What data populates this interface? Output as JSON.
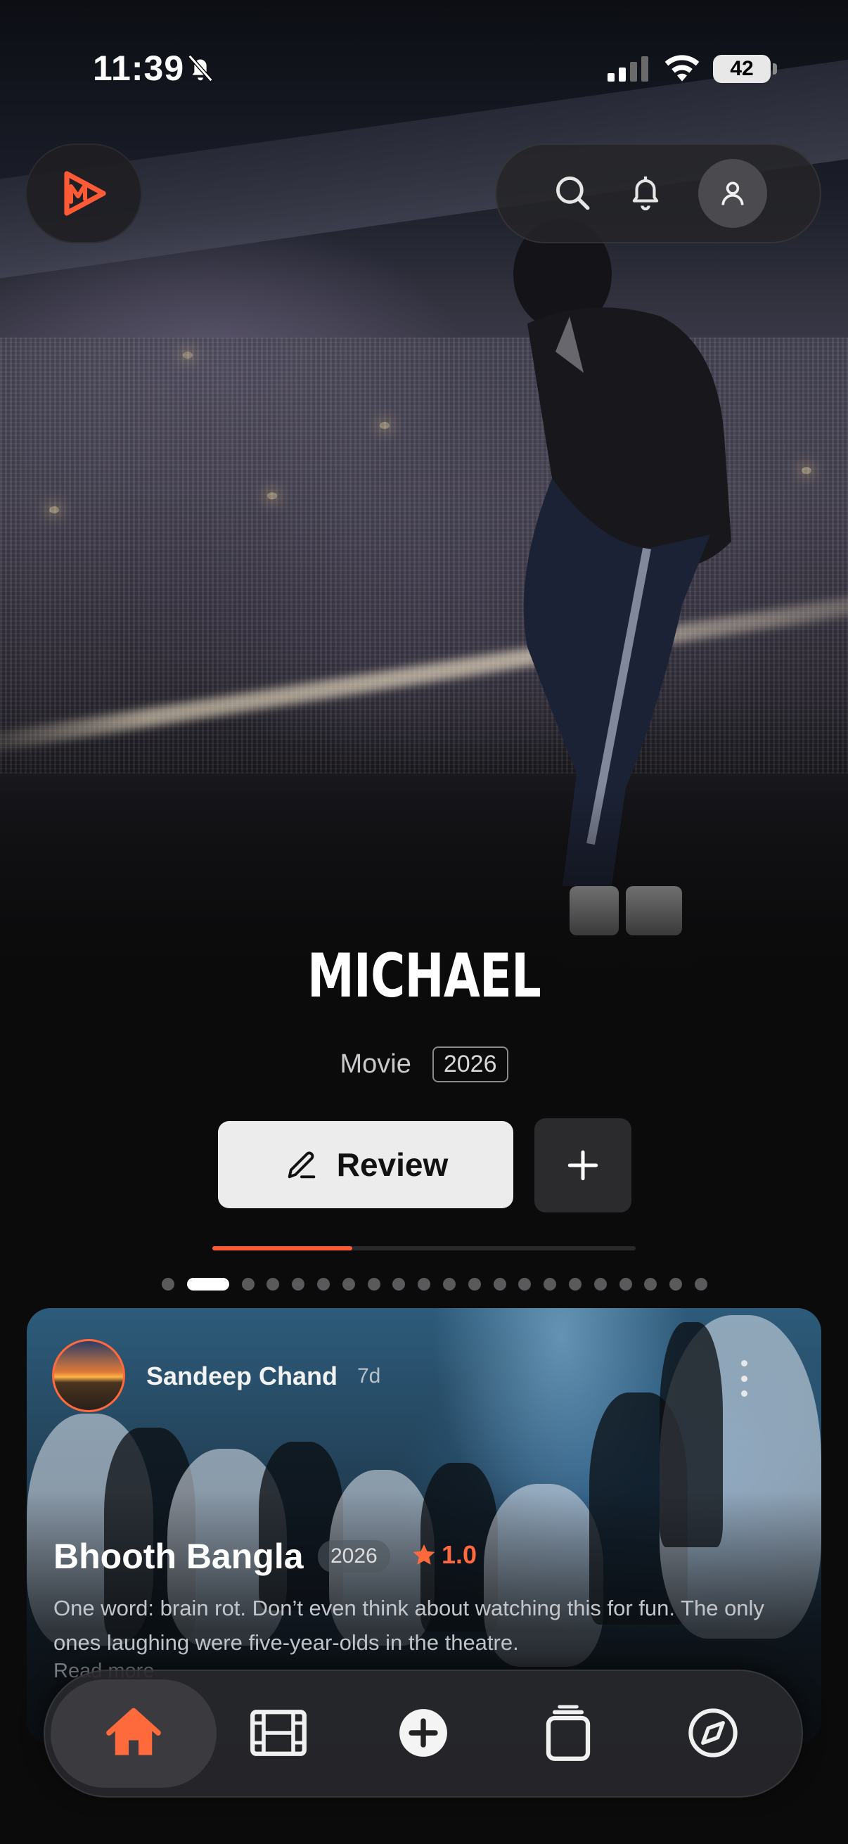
{
  "status_bar": {
    "time": "11:39",
    "battery": "42"
  },
  "top_bar": {
    "logo_icon": "play-logo-icon",
    "actions": [
      "search-icon",
      "bell-icon",
      "profile-icon"
    ]
  },
  "featured": {
    "title": "MICHAEL",
    "type": "Movie",
    "year": "2026",
    "review_label": "Review",
    "carousel_progress": 0.33,
    "slide_count": 21,
    "active_slide": 2
  },
  "review_card": {
    "reviewer": "Sandeep Chand",
    "age": "7d",
    "movie_title": "Bhooth Bangla",
    "year": "2026",
    "rating": "1.0",
    "text": "One word: brain rot. Don’t even think about watching this for fun. The only ones laughing were five-year-olds in the theatre.",
    "read_more": "Read more"
  },
  "bottom_nav": {
    "items": [
      "home-icon",
      "film-icon",
      "add-circle-icon",
      "collections-icon",
      "explore-compass-icon"
    ],
    "active": "home-icon",
    "accent": "#ff6a3d"
  },
  "colors": {
    "accent": "#ff5a36",
    "background": "#0b0b0c"
  }
}
